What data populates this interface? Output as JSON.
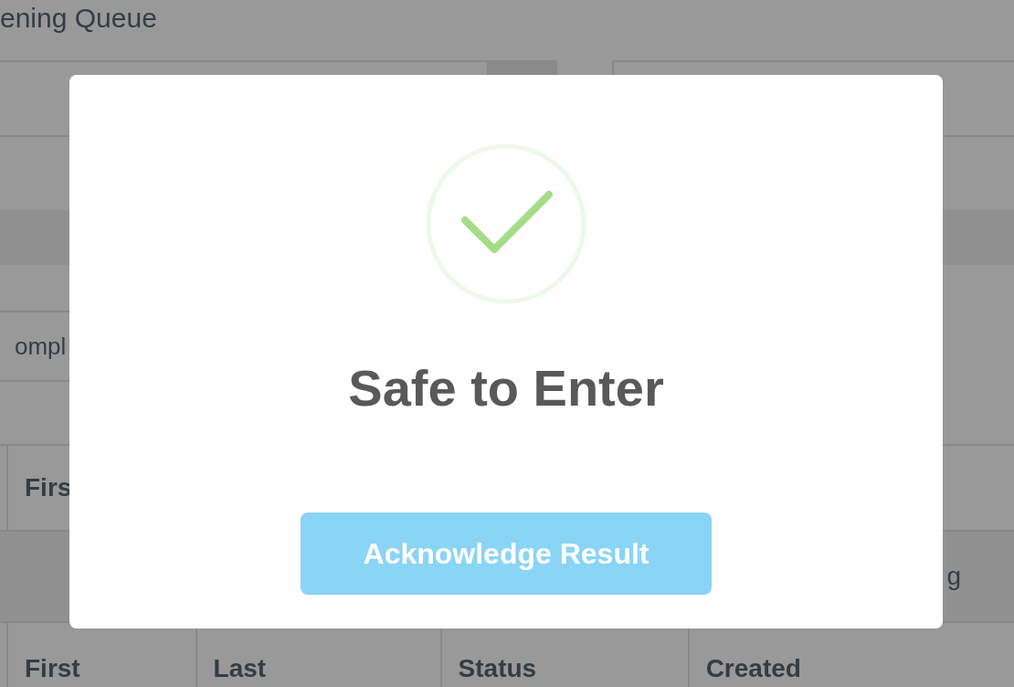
{
  "background": {
    "heading": "ening Queue",
    "filter_button": "ompl",
    "table_1": {
      "columns": [
        "Firs"
      ],
      "rows": [
        [
          "g"
        ]
      ]
    },
    "table_2": {
      "columns": [
        "First",
        "Last",
        "Status",
        "Created"
      ]
    }
  },
  "dialog": {
    "kind": "success",
    "title": "Safe to Enter",
    "button": "Acknowledge Result"
  }
}
